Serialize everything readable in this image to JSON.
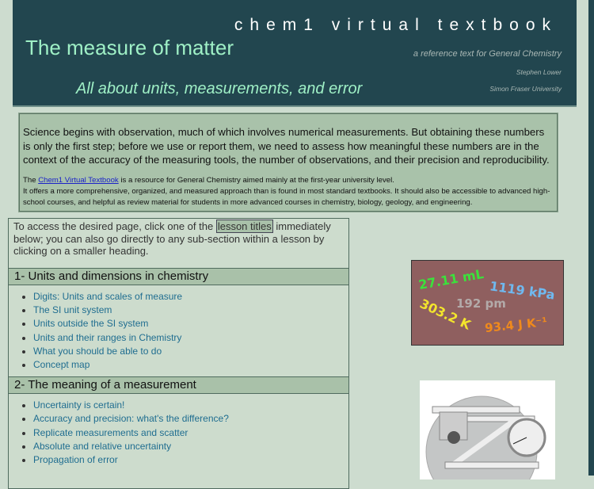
{
  "header": {
    "brand": "chem1 virtual textbook",
    "title": "The measure of matter",
    "subtitle": "All about units, measurements, and error",
    "tagline": "a reference text for General Chemistry",
    "author": "Stephen Lower",
    "institution": "Simon Fraser University"
  },
  "intro": {
    "main": "Science begins with observation, much of which involves numerical measurements. But obtaining these numbers is only the first step;  before we use or report them, we need to assess how meaningful these numbers are in the context of the accuracy of the measuring tools, the number of observations, and their precision and reproducibility.",
    "link": "Chem1 Virtual Textbook",
    "after_link": " is a resource for General Chemistry aimed mainly at the first-year university level.",
    "the": "The ",
    "line2": "It offers a more comprehensive, organized, and measured approach than is found in most standard textbooks. It should also be accessible to advanced high-school courses, and helpful as review material for students in more advanced courses in chemistry, biology, geology, and engineering."
  },
  "lessons": {
    "lead_a": "To access the desired page, click one of the ",
    "lead_hl": "lesson titles",
    "lead_b": " immediately below; you can also go directly to any sub-section within a lesson by clicking on a smaller heading.",
    "sections": [
      {
        "title": "1- Units and dimensions in chemistry",
        "items": [
          "Digits: Units and scales of measure",
          "The SI unit system",
          "Units outside the SI system",
          "Units and their ranges in Chemistry",
          "What you should be able to do",
          "Concept map"
        ]
      },
      {
        "title": "2- The meaning of a measurement",
        "items": [
          "Uncertainty is certain!",
          "Accuracy and precision: what's the difference?",
          "Replicate measurements and scatter",
          "Absolute and relative uncertainty",
          "Propagation of error"
        ]
      }
    ]
  },
  "image_units": [
    "27.11 mL",
    "1119 kPa",
    "192 pm",
    "303.2 K",
    "93.4 J K⁻¹"
  ]
}
